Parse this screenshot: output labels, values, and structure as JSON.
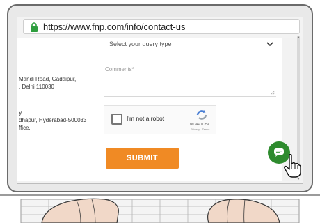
{
  "browser": {
    "url": "https://www.fnp.com/info/contact-us"
  },
  "address_column": {
    "lines": [
      "Mandi Road, Gadaipur,",
      ", Delhi 110030",
      "y",
      "dhapur, Hyderabad-500033",
      "ffice."
    ]
  },
  "form": {
    "query_select": {
      "selected": "Select your query type"
    },
    "comments": {
      "placeholder": "Comments*"
    },
    "captcha": {
      "label": "I'm not a robot",
      "brand": "reCAPTCHA",
      "links": "Privacy - Terms"
    },
    "submit_label": "SUBMIT"
  },
  "icons": {
    "lock": "lock-icon",
    "chevron": "chevron-down-icon",
    "recaptcha": "recaptcha-icon",
    "chat": "chat-icon",
    "cursor": "cursor-icon"
  },
  "colors": {
    "lock": "#2e9e3e",
    "submit": "#f08a24",
    "chat_button": "#2e8b2e",
    "bezel": "#e9e9e9"
  }
}
